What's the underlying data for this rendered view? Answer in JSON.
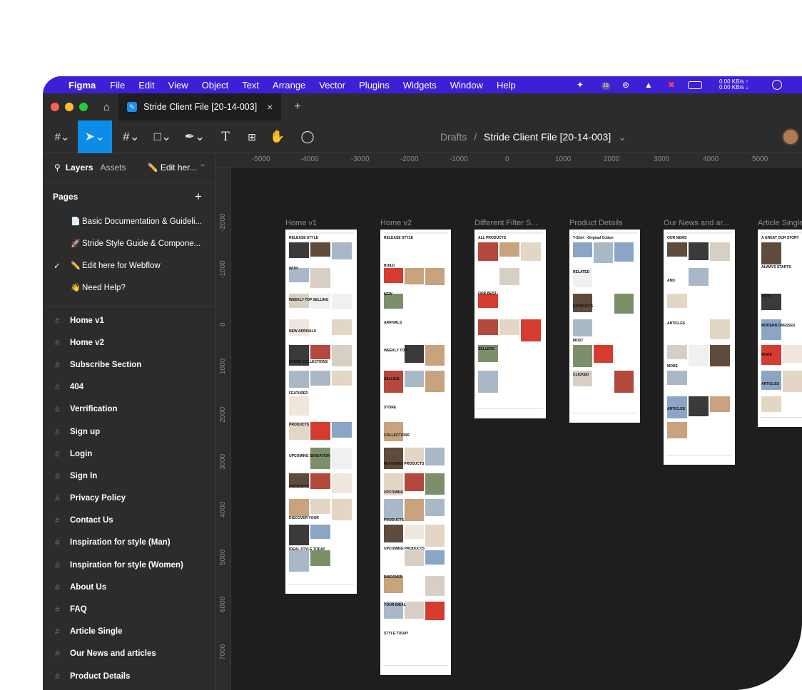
{
  "menubar": {
    "app": "Figma",
    "items": [
      "File",
      "Edit",
      "View",
      "Object",
      "Text",
      "Arrange",
      "Vector",
      "Plugins",
      "Widgets",
      "Window",
      "Help"
    ],
    "net_up": "0.00 KB/s ↑",
    "net_down": "0.00 KB/s ↓",
    "badge": "15"
  },
  "tabbar": {
    "file_tab": "Stride Client File [20-14-003]",
    "close": "×",
    "new_tab": "+"
  },
  "toolbar": {
    "text_tool": "T",
    "breadcrumb_root": "Drafts",
    "breadcrumb_sep": "/",
    "breadcrumb_file": "Stride Client File [20-14-003]",
    "chevron": "⌄"
  },
  "sidebar": {
    "tabs": {
      "layers": "Layers",
      "assets": "Assets",
      "page_dropdown": "Edit her..."
    },
    "pages_title": "Pages",
    "add": "+",
    "pages": [
      {
        "emoji": "📄",
        "label": "Basic Documentation & Guideli...",
        "current": false
      },
      {
        "emoji": "🚀",
        "label": "Stride Style Guide & Compone...",
        "current": false
      },
      {
        "emoji": "✏️",
        "label": "Edit here for Webflow",
        "current": true
      },
      {
        "emoji": "👋",
        "label": "Need Help?",
        "current": false
      }
    ],
    "layers": [
      "Home v1",
      "Home v2",
      "Subscribe Section",
      "404",
      "Verrification",
      "Sign up",
      "Login",
      "Sign In",
      "Privacy Policy",
      "Contact Us",
      "Inspiration for style (Man)",
      "Inspiration for style (Women)",
      "About Us",
      "FAQ",
      "Article Single",
      "Our News and articles",
      "Product Details"
    ]
  },
  "rulers": {
    "top": [
      "-5000",
      "-4000",
      "-3000",
      "-2000",
      "-1000",
      "0",
      "1000",
      "2000",
      "3000",
      "4000",
      "5000"
    ],
    "left": [
      "-2000",
      "-1000",
      "0",
      "1000",
      "2000",
      "3000",
      "4000",
      "5000",
      "6000",
      "7000"
    ]
  },
  "frames": [
    {
      "label": "Home v1",
      "texts": [
        "RELEASE STYLE",
        "WITH",
        "WEEKLY TOP SELLING",
        "NEW ARRIVALS",
        "STORE COLLECTIONS",
        "FEATURED",
        "PRODUCTS",
        "UPCOMING SENSATION",
        "PRODUCTS",
        "DISCOVER YOUR",
        "IDEAL STYLE TODAY"
      ]
    },
    {
      "label": "Home v2",
      "texts": [
        "RELEASE STYLE",
        "BUILD",
        "NEW",
        "ARRIVALS",
        "WEEKLY TOP",
        "SELLING",
        "STORE",
        "COLLECTIONS",
        "FEATURED PRODUCTS",
        "UPCOMING",
        "PRODUCTS",
        "UPCOMING PRODUCTS",
        "DISCOVER",
        "YOUR IDEAL",
        "STYLE TODAY"
      ]
    },
    {
      "label": "Different Filter S...",
      "texts": [
        "ALL PRODUCTS",
        "OUR BEST",
        "SELLERS"
      ]
    },
    {
      "label": "Product Details",
      "texts": [
        "T-Shirt - Original Cotton",
        "RELATED",
        "PRODUCTS",
        "MOST",
        "CLICKED"
      ]
    },
    {
      "label": "Our News and ar...",
      "texts": [
        "OUR NEWS",
        "AND",
        "ARTICLES",
        "MORE",
        "ARTICLES"
      ]
    },
    {
      "label": "Article Single",
      "texts": [
        "A GREAT OUR STORY",
        "ALWAYS STARTS",
        "WITH",
        "MODERN DRESSES",
        "MORE",
        "ARTICLES"
      ]
    }
  ]
}
